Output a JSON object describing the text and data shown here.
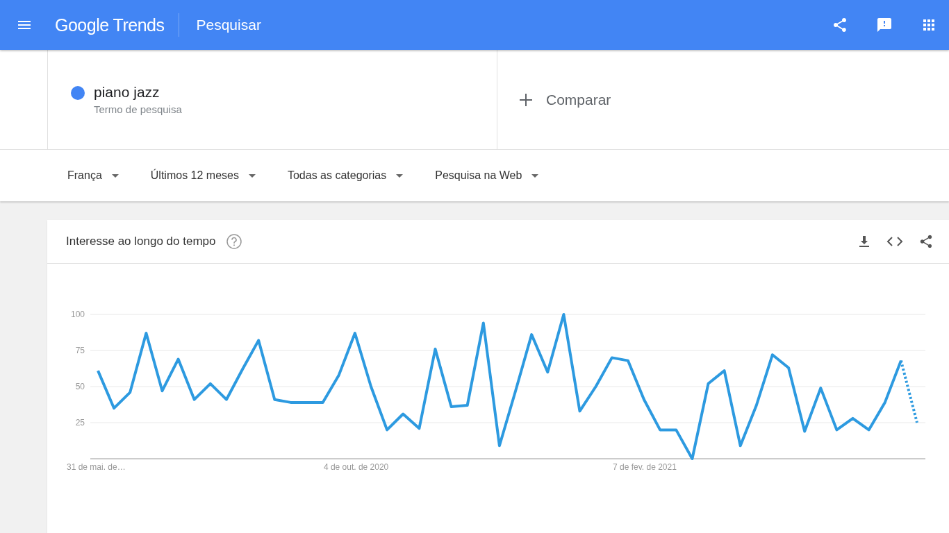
{
  "header": {
    "logo": "Google Trends",
    "section": "Pesquisar"
  },
  "search_terms": [
    {
      "term": "piano jazz",
      "subtitle": "Termo de pesquisa",
      "color": "#4285f4"
    }
  ],
  "compare": {
    "label": "Comparar"
  },
  "filters": [
    {
      "label": "França"
    },
    {
      "label": "Últimos 12 meses"
    },
    {
      "label": "Todas as categorias"
    },
    {
      "label": "Pesquisa na Web"
    }
  ],
  "interest_card": {
    "title": "Interesse ao longo do tempo",
    "chart_data": {
      "type": "line",
      "grid": true,
      "ylim": [
        0,
        100
      ],
      "yticks": [
        25,
        50,
        75,
        100
      ],
      "categories": [
        "31 de mai. de…",
        null,
        null,
        null,
        null,
        null,
        null,
        null,
        null,
        null,
        null,
        null,
        null,
        null,
        null,
        null,
        "4 de out. de 2020",
        null,
        null,
        null,
        null,
        null,
        null,
        null,
        null,
        null,
        null,
        null,
        null,
        null,
        null,
        null,
        null,
        null,
        "7 de fev. de 2021",
        null,
        null,
        null,
        null,
        null,
        null,
        null,
        null,
        null,
        null,
        null,
        null,
        null,
        null,
        null,
        null,
        null
      ],
      "series": [
        {
          "color": "#2d9ae0",
          "line_style": "solid",
          "values": [
            61,
            35,
            46,
            87,
            47,
            69,
            41,
            52,
            41,
            62,
            82,
            41,
            39,
            39,
            39,
            58,
            87,
            50,
            20,
            31,
            21,
            76,
            36,
            37,
            94,
            9,
            47,
            86,
            60,
            100,
            33,
            50,
            70,
            68,
            41,
            20,
            20,
            0,
            52,
            61,
            9,
            37,
            72,
            63,
            19,
            49,
            20,
            28,
            20,
            39,
            68,
            null
          ]
        },
        {
          "color": "#2d9ae0",
          "line_style": "dotted",
          "values": [
            null,
            null,
            null,
            null,
            null,
            null,
            null,
            null,
            null,
            null,
            null,
            null,
            null,
            null,
            null,
            null,
            null,
            null,
            null,
            null,
            null,
            null,
            null,
            null,
            null,
            null,
            null,
            null,
            null,
            null,
            null,
            null,
            null,
            null,
            null,
            null,
            null,
            null,
            null,
            null,
            null,
            null,
            null,
            null,
            null,
            null,
            null,
            null,
            null,
            null,
            68,
            25
          ]
        }
      ]
    }
  }
}
